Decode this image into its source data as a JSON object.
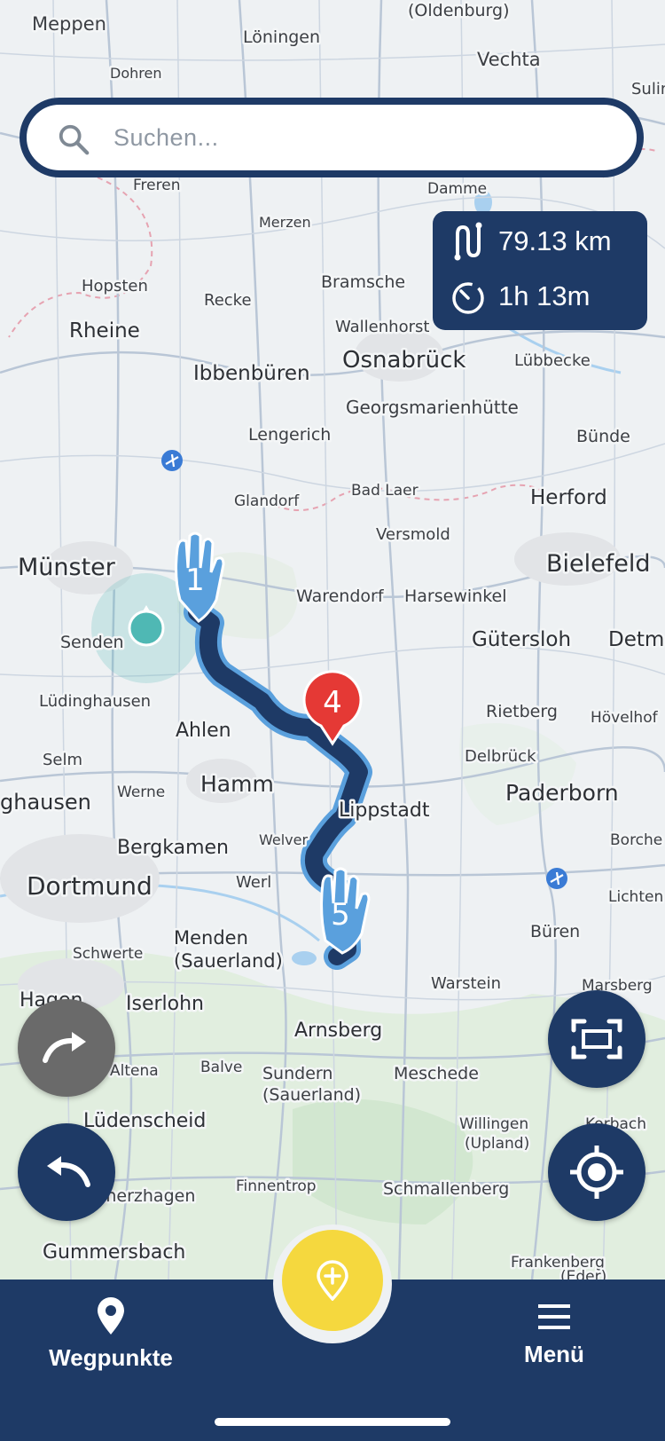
{
  "search": {
    "placeholder": "Suchen..."
  },
  "route_stats": {
    "distance": "79.13 km",
    "duration": "1h 13m"
  },
  "waypoints": {
    "start": "1",
    "via": "4",
    "end": "5"
  },
  "map_labels": {
    "meppen": "Meppen",
    "oldenburg": "(Oldenburg)",
    "loningen": "Löningen",
    "vechta": "Vechta",
    "dohren": "Dohren",
    "sulin": "Sulin",
    "freren": "Freren",
    "damme": "Damme",
    "merzen": "Merzen",
    "hopsten": "Hopsten",
    "recke": "Recke",
    "bramsche": "Bramsche",
    "rheine": "Rheine",
    "wallenhorst": "Wallenhorst",
    "osnabruck": "Osnabrück",
    "lubbecke": "Lübbecke",
    "ibbenburen": "Ibbenbüren",
    "georgsmarienhutte": "Georgsmarienhütte",
    "lengerich": "Lengerich",
    "bunde": "Bünde",
    "glandorf": "Glandorf",
    "bad_laer": "Bad Laer",
    "herford": "Herford",
    "versmold": "Versmold",
    "munster": "Münster",
    "bielefeld": "Bielefeld",
    "warendorf": "Warendorf",
    "harsewinkel": "Harsewinkel",
    "senden": "Senden",
    "gutersloh": "Gütersloh",
    "detmold": "Detmo",
    "ludinghausen": "Lüdinghausen",
    "rietberg": "Rietberg",
    "hovelhof": "Hövelhof",
    "ahlen": "Ahlen",
    "selm": "Selm",
    "delbruck": "Delbrück",
    "hamm": "Hamm",
    "paderborn": "Paderborn",
    "werne": "Werne",
    "ghausen": "ghausen",
    "lippstadt": "Lippstadt",
    "welver": "Welver",
    "borchen": "Borche",
    "bergkamen": "Bergkamen",
    "dortmund": "Dortmund",
    "werl": "Werl",
    "lichtenau": "Lichten",
    "schwerte": "Schwerte",
    "menden": "Menden",
    "sauerland1": "(Sauerland)",
    "buren": "Büren",
    "warstein": "Warstein",
    "marsberg": "Marsberg",
    "hagen": "Hagen",
    "iserlohn": "Iserlohn",
    "arnsberg": "Arnsberg",
    "altena": "Altena",
    "balve": "Balve",
    "sundern": "Sundern",
    "sauerland2": "(Sauerland)",
    "meschede": "Meschede",
    "ludenscheid": "Lüdenscheid",
    "willingen": "Willingen",
    "upland": "(Upland)",
    "korbach": "Korbach",
    "meinerzhagen": "Meinerzhagen",
    "finnentrop": "Finnentrop",
    "schmallenberg": "Schmallenberg",
    "gummersbach": "Gummersbach",
    "frankenberg": "Frankenberg",
    "eder": "(Eder)"
  },
  "bottom_nav": {
    "waypoints_label": "Wegpunkte",
    "menu_label": "Menü"
  },
  "colors": {
    "primary": "#1e3a66",
    "accent": "#f5d83e",
    "via_marker": "#e53935",
    "route_casing": "#5aa0dd",
    "user_location": "#4fb8b4"
  }
}
